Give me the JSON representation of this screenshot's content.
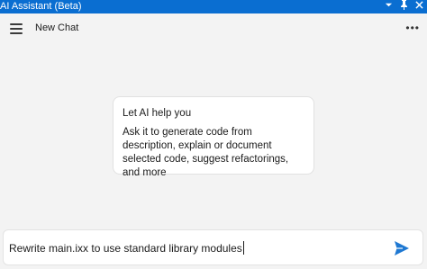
{
  "window": {
    "title": "AI Assistant (Beta)",
    "icons": [
      "chevron-down-icon",
      "pin-icon",
      "close-icon"
    ]
  },
  "header": {
    "chat_title": "New Chat",
    "menu_icon": "hamburger-menu-icon",
    "more_icon": "more-options-icon",
    "more_glyph": "•••"
  },
  "intro_card": {
    "heading": "Let AI help you",
    "body": "Ask it to generate code from description, explain or document selected code, suggest refactorings, and more"
  },
  "prompt": {
    "value": "Rewrite main.ixx to use standard library modules",
    "send_icon": "send-icon",
    "accent": "#1e78d2"
  },
  "colors": {
    "title_bar": "#0a6ed1",
    "background": "#f3f3f3",
    "card": "#ffffff"
  }
}
